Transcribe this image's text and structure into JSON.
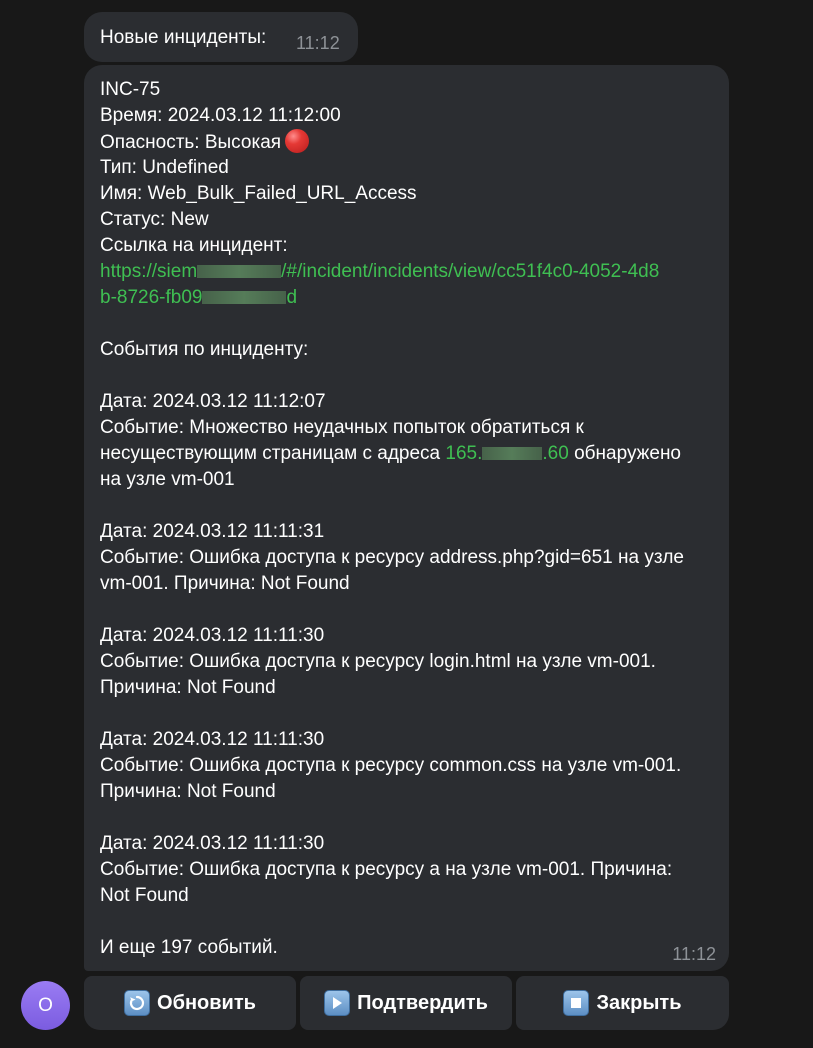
{
  "messages": {
    "header_text": "Новые инциденты:",
    "header_time": "11:12",
    "main_time": "11:12",
    "lines": {
      "inc_id": "INC-75",
      "time": "Время: 2024.03.12 11:12:00",
      "severity": "Опасность: Высокая",
      "type": "Тип: Undefined",
      "name": "Имя: Web_Bulk_Failed_URL_Access",
      "status": "Статус: New",
      "link_label": "Ссылка на инцидент:",
      "link_part1": "https://siem",
      "link_part2": "/#/incident/incidents/view/cc51f4c0-4052-4d8",
      "link_part3": "b-8726-fb09",
      "link_part4": "d",
      "events_header": "События по инциденту:",
      "e1_date": "Дата: 2024.03.12 11:12:07",
      "e1_l1": "Событие: Множество неудачных попыток обратиться к",
      "e1_l2a": "несуществующим страницам с адреса ",
      "e1_ip_a": "165.",
      "e1_ip_b": ".60",
      "e1_l2b": " обнаружено",
      "e1_l3": "на узле vm-001",
      "e2_date": "Дата: 2024.03.12 11:11:31",
      "e2_l1": "Событие: Ошибка доступа к ресурсу address.php?gid=651 на узле",
      "e2_l2": "vm-001. Причина: Not Found",
      "e3_date": "Дата: 2024.03.12 11:11:30",
      "e3_l1": "Событие: Ошибка доступа к ресурсу login.html на узле vm-001.",
      "e3_l2": "Причина: Not Found",
      "e4_date": "Дата: 2024.03.12 11:11:30",
      "e4_l1": "Событие: Ошибка доступа к ресурсу common.css на узле vm-001.",
      "e4_l2": "Причина: Not Found",
      "e5_date": "Дата: 2024.03.12 11:11:30",
      "e5_l1": "Событие: Ошибка доступа к ресурсу a на узле vm-001. Причина:",
      "e5_l2": "Not Found",
      "more": "И еще 197 событий."
    }
  },
  "avatar": {
    "letter": "O",
    "color": "#8b6cf0"
  },
  "keyboard": {
    "refresh_label": "Обновить",
    "confirm_label": "Подтвердить",
    "close_label": "Закрыть"
  },
  "icons": {
    "severity": "red-circle-icon",
    "refresh": "refresh-icon",
    "confirm": "play-icon",
    "close": "stop-icon"
  },
  "colors": {
    "background": "#181818",
    "bubble": "#2b2d31",
    "link": "#3fbf52",
    "time": "#8e9297"
  }
}
